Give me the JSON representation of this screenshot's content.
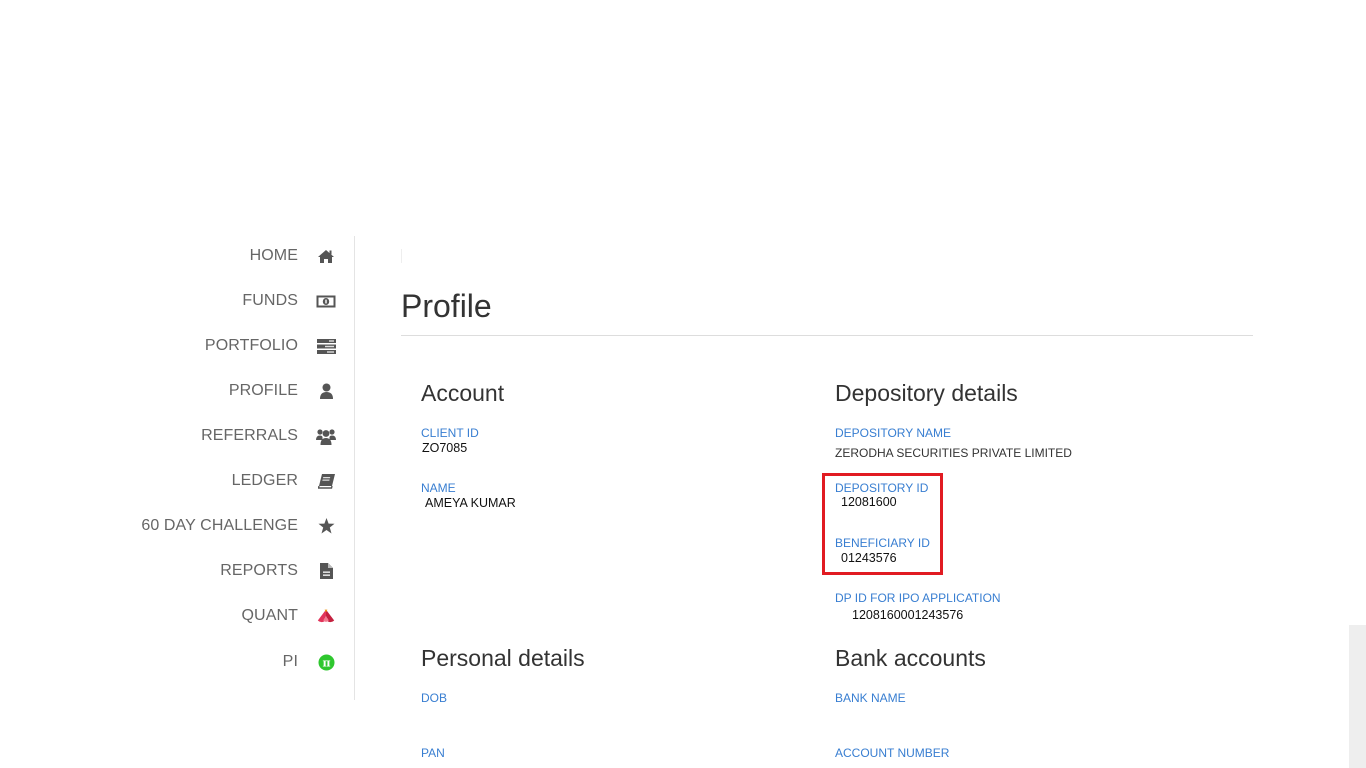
{
  "sidebar": {
    "items": [
      {
        "label": "HOME",
        "icon": "home-icon"
      },
      {
        "label": "FUNDS",
        "icon": "money-icon"
      },
      {
        "label": "PORTFOLIO",
        "icon": "server-icon"
      },
      {
        "label": "PROFILE",
        "icon": "user-icon"
      },
      {
        "label": "REFERRALS",
        "icon": "users-icon"
      },
      {
        "label": "LEDGER",
        "icon": "book-icon"
      },
      {
        "label": "60 DAY CHALLENGE",
        "icon": "star-icon"
      },
      {
        "label": "REPORTS",
        "icon": "file-icon"
      },
      {
        "label": "QUANT",
        "icon": "quant-logo-icon"
      },
      {
        "label": "PI",
        "icon": "pi-logo-icon"
      }
    ]
  },
  "main": {
    "title": "Profile",
    "account": {
      "heading": "Account",
      "client_id_label": "CLIENT ID",
      "client_id": "ZO7085",
      "name_label": "NAME",
      "name": "AMEYA KUMAR"
    },
    "depository": {
      "heading": "Depository details",
      "depository_name_label": "DEPOSITORY NAME",
      "depository_name": "ZERODHA SECURITIES PRIVATE LIMITED",
      "depository_id_label": "DEPOSITORY ID",
      "depository_id": "12081600",
      "beneficiary_id_label": "BENEFICIARY ID",
      "beneficiary_id": "01243576",
      "dp_id_ipo_label": "DP ID FOR IPO APPLICATION",
      "dp_id_ipo": "1208160001243576"
    },
    "personal": {
      "heading": "Personal details",
      "dob_label": "DOB",
      "pan_label": "PAN"
    },
    "bank": {
      "heading": "Bank accounts",
      "bank_name_label": "BANK NAME",
      "account_number_label": "ACCOUNT NUMBER"
    }
  },
  "colors": {
    "label_blue": "#387ed1",
    "highlight_red": "#e11b22",
    "icon_grey": "#555555",
    "quant_red": "#e2345a",
    "pi_green": "#2ec72e"
  }
}
